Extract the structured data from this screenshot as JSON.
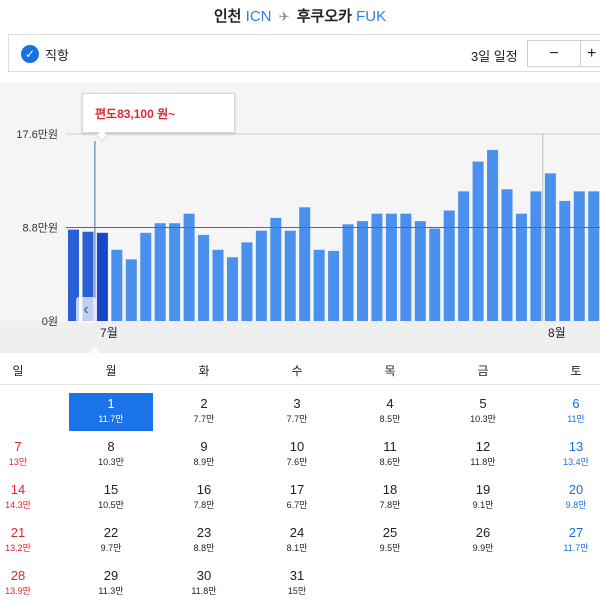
{
  "route": {
    "origin_city": "인천",
    "origin_code": "ICN",
    "dest_city": "후쿠오카",
    "dest_code": "FUK"
  },
  "options": {
    "direct_label": "직항",
    "trip_length_label": "3일 일정",
    "minus_label": "−",
    "plus_label": "+"
  },
  "tooltip": {
    "text": "편도83,100 원~"
  },
  "colors": {
    "bar": "#4a90ee",
    "bar_selected": "#1746c8",
    "accent": "#1a6fe0",
    "sunday": "#e0272b"
  },
  "chart_data": {
    "type": "bar",
    "title": "",
    "y_tick_labels": [
      "17.6만원",
      "8.8만원",
      "0원"
    ],
    "ylim": [
      0,
      17.6
    ],
    "reference_line": 8.8,
    "month_labels": [
      "7월",
      "8월"
    ],
    "selected_day_index": 2,
    "bars": [
      {
        "day": "6/29",
        "value": 8.6
      },
      {
        "day": "6/30",
        "value": 8.4
      },
      {
        "day": "7/1",
        "value": 8.3,
        "selected": true
      },
      {
        "day": "7/2",
        "value": 6.7
      },
      {
        "day": "7/3",
        "value": 5.8
      },
      {
        "day": "7/4",
        "value": 8.3
      },
      {
        "day": "7/5",
        "value": 9.2
      },
      {
        "day": "7/6",
        "value": 9.2
      },
      {
        "day": "7/7",
        "value": 10.1
      },
      {
        "day": "7/8",
        "value": 8.1
      },
      {
        "day": "7/9",
        "value": 6.7
      },
      {
        "day": "7/10",
        "value": 6.0
      },
      {
        "day": "7/11",
        "value": 7.4
      },
      {
        "day": "7/12",
        "value": 8.5
      },
      {
        "day": "7/13",
        "value": 9.7
      },
      {
        "day": "7/14",
        "value": 8.5
      },
      {
        "day": "7/15",
        "value": 10.7
      },
      {
        "day": "7/16",
        "value": 6.7
      },
      {
        "day": "7/17",
        "value": 6.6
      },
      {
        "day": "7/18",
        "value": 9.1
      },
      {
        "day": "7/19",
        "value": 9.4
      },
      {
        "day": "7/20",
        "value": 10.1
      },
      {
        "day": "7/21",
        "value": 10.1
      },
      {
        "day": "7/22",
        "value": 10.1
      },
      {
        "day": "7/23",
        "value": 9.4
      },
      {
        "day": "7/24",
        "value": 8.7
      },
      {
        "day": "7/25",
        "value": 10.4
      },
      {
        "day": "7/26",
        "value": 12.2
      },
      {
        "day": "7/27",
        "value": 15.0
      },
      {
        "day": "7/28",
        "value": 16.1
      },
      {
        "day": "7/29",
        "value": 12.4
      },
      {
        "day": "7/30",
        "value": 10.1
      },
      {
        "day": "7/31",
        "value": 12.2
      },
      {
        "day": "8/1",
        "value": 13.9
      },
      {
        "day": "8/2",
        "value": 11.3
      },
      {
        "day": "8/3",
        "value": 12.2
      },
      {
        "day": "8/4",
        "value": 12.2
      },
      {
        "day": "8/5",
        "value": 10.4
      }
    ]
  },
  "calendar": {
    "weekdays": [
      "일",
      "월",
      "화",
      "수",
      "목",
      "금",
      "토"
    ],
    "weeks": [
      [
        null,
        {
          "day": "1",
          "price": "11.7만",
          "selected": true
        },
        {
          "day": "2",
          "price": "7.7만"
        },
        {
          "day": "3",
          "price": "7.7만"
        },
        {
          "day": "4",
          "price": "8.5만"
        },
        {
          "day": "5",
          "price": "10.3만"
        },
        {
          "day": "6",
          "price": "11만"
        }
      ],
      [
        {
          "day": "7",
          "price": "13만"
        },
        {
          "day": "8",
          "price": "10.3만"
        },
        {
          "day": "9",
          "price": "8.9만"
        },
        {
          "day": "10",
          "price": "7.6만"
        },
        {
          "day": "11",
          "price": "8.6만"
        },
        {
          "day": "12",
          "price": "11.8만"
        },
        {
          "day": "13",
          "price": "13.4만"
        }
      ],
      [
        {
          "day": "14",
          "price": "14.3만"
        },
        {
          "day": "15",
          "price": "10.5만"
        },
        {
          "day": "16",
          "price": "7.8만"
        },
        {
          "day": "17",
          "price": "6.7만"
        },
        {
          "day": "18",
          "price": "7.8만"
        },
        {
          "day": "19",
          "price": "9.1만"
        },
        {
          "day": "20",
          "price": "9.8만"
        }
      ],
      [
        {
          "day": "21",
          "price": "13.2만"
        },
        {
          "day": "22",
          "price": "9.7만"
        },
        {
          "day": "23",
          "price": "8.8만"
        },
        {
          "day": "24",
          "price": "8.1만"
        },
        {
          "day": "25",
          "price": "9.5만"
        },
        {
          "day": "26",
          "price": "9.9만"
        },
        {
          "day": "27",
          "price": "11.7만"
        }
      ],
      [
        {
          "day": "28",
          "price": "13.9만"
        },
        {
          "day": "29",
          "price": "11.3만"
        },
        {
          "day": "30",
          "price": "11.8만"
        },
        {
          "day": "31",
          "price": "15만"
        },
        null,
        null,
        null
      ]
    ]
  }
}
